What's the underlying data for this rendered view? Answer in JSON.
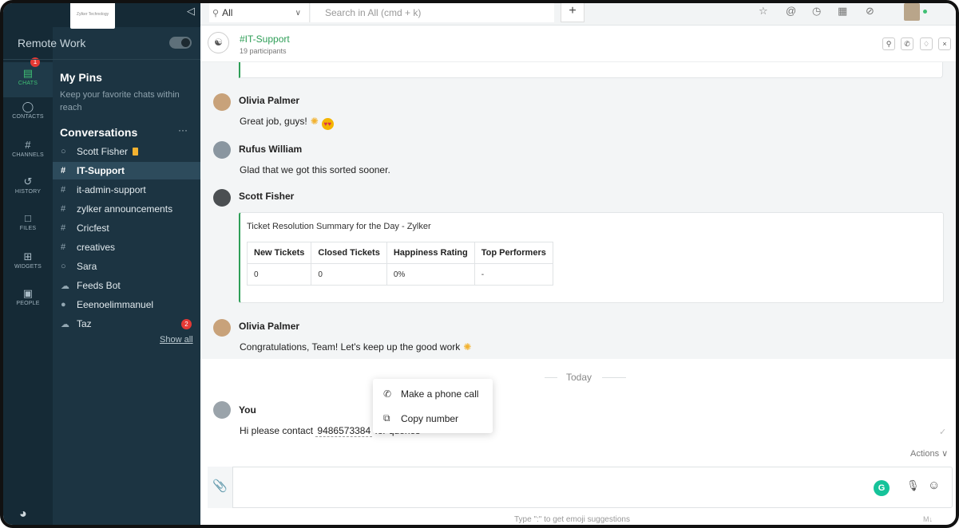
{
  "topbar": {
    "scope": "All",
    "search_placeholder": "Search in All (cmd + k)",
    "plus": "+",
    "logo_text": "Zylker Technology"
  },
  "rail": {
    "badge": "1",
    "items": [
      {
        "label": "CHATS",
        "icon": "chat-icon"
      },
      {
        "label": "CONTACTS",
        "icon": "person-icon"
      },
      {
        "label": "CHANNELS",
        "icon": "hash-icon"
      },
      {
        "label": "HISTORY",
        "icon": "history-icon"
      },
      {
        "label": "FILES",
        "icon": "file-icon"
      },
      {
        "label": "WIDGETS",
        "icon": "grid-icon"
      },
      {
        "label": "PEOPLE",
        "icon": "id-card-icon"
      }
    ]
  },
  "sidebar": {
    "workspace": "Remote Work",
    "pins_title": "My Pins",
    "pins_sub": "Keep your favorite chats within reach",
    "conversations_title": "Conversations",
    "more": "···",
    "items": [
      {
        "icon": "○",
        "label": "Scott Fisher"
      },
      {
        "icon": "#",
        "label": "IT-Support"
      },
      {
        "icon": "#",
        "label": "it-admin-support"
      },
      {
        "icon": "#",
        "label": "zylker announcements"
      },
      {
        "icon": "#",
        "label": "Cricfest"
      },
      {
        "icon": "#",
        "label": "creatives"
      },
      {
        "icon": "○",
        "label": "Sara"
      },
      {
        "icon": "☁",
        "label": "Feeds Bot"
      },
      {
        "icon": "●",
        "label": "Eeenoelimmanuel"
      },
      {
        "icon": "☁",
        "label": "Taz"
      }
    ],
    "taz_badge": "2",
    "show_all": "Show all"
  },
  "chat": {
    "name": "#IT-Support",
    "participants": "19 participants",
    "messages": [
      {
        "author": "Olivia Palmer",
        "text": "Great job, guys!"
      },
      {
        "author": "Rufus William",
        "text": "Glad that we got this sorted sooner."
      },
      {
        "author": "Scott Fisher",
        "text": ""
      },
      {
        "author": "Olivia Palmer",
        "text": "Congratulations, Team! Let's keep up the good work"
      }
    ],
    "card": {
      "title": "Ticket Resolution Summary for the Day - Zylker",
      "headers": [
        "New Tickets",
        "Closed Tickets",
        "Happiness Rating",
        "Top Performers"
      ],
      "row": [
        "0",
        "0",
        "0%",
        "-"
      ]
    },
    "today": "Today",
    "you": {
      "author": "You",
      "text_before": "Hi please contact",
      "phone": "9486573384",
      "text_after": "for queries"
    },
    "actions": "Actions ∨"
  },
  "context_menu": {
    "call": "Make a phone call",
    "copy": "Copy number"
  },
  "composer": {
    "hint": "Type \":\" to get emoji suggestions",
    "md": "M↓"
  }
}
